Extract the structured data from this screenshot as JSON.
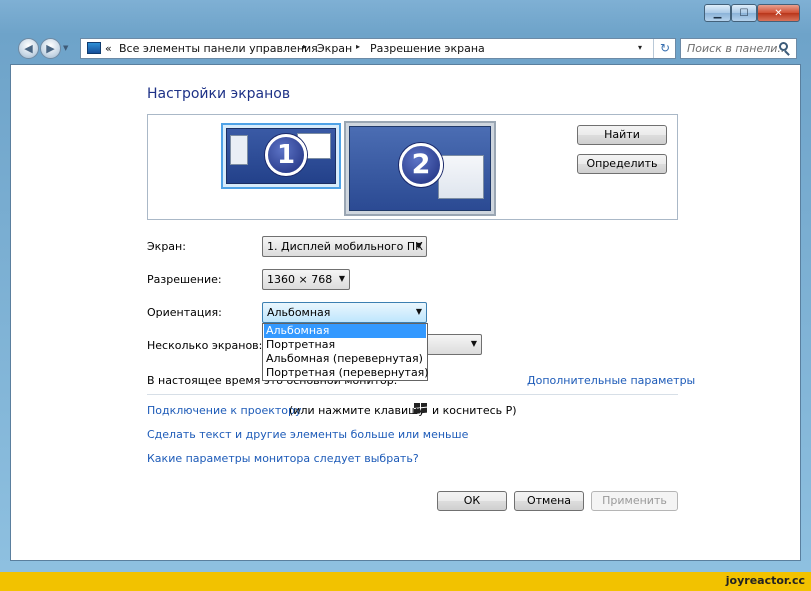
{
  "window": {
    "minimize_icon": "minimize-icon",
    "maximize_icon": "maximize-icon",
    "close_icon": "close-icon",
    "min_glyph": "▁",
    "max_glyph": "☐",
    "close_glyph": "✕"
  },
  "address": {
    "overflow": "«",
    "crumbs": [
      "Все элементы панели управления",
      "Экран",
      "Разрешение экрана"
    ],
    "separator": "▸",
    "dropdown_glyph": "▾",
    "refresh_glyph": "↻"
  },
  "search": {
    "placeholder": "Поиск в панели..."
  },
  "main": {
    "title": "Настройки экранов",
    "monitors": [
      "1",
      "2"
    ],
    "find_button": "Найти",
    "identify_button": "Определить",
    "display_label": "Экран:",
    "display_value": "1. Дисплей мобильного ПК",
    "resolution_label": "Разрешение:",
    "resolution_value": "1360 × 768",
    "orientation_label": "Ориентация:",
    "orientation_value": "Альбомная",
    "orientation_options": [
      "Альбомная",
      "Портретная",
      "Альбомная (перевернутая)",
      "Портретная (перевернутая)"
    ],
    "multiple_label": "Несколько экранов:",
    "primary_text": "В настоящее время это основной монитор.",
    "advanced_link": "Дополнительные параметры",
    "projector_link": "Подключение к проектору",
    "projector_hint_a": "(или нажмите клавишу",
    "projector_hint_b": "и коснитесь P)",
    "textsize_link": "Сделать текст и другие элементы больше или меньше",
    "which_link": "Какие параметры монитора следует выбрать?"
  },
  "footer": {
    "ok": "ОК",
    "cancel": "Отмена",
    "apply": "Применить"
  },
  "watermark": "joyreactor.cc",
  "colors": {
    "title": "#1e3287",
    "link": "#1d5bb8",
    "selection": "#3399ff",
    "strip": "#f2c200"
  }
}
